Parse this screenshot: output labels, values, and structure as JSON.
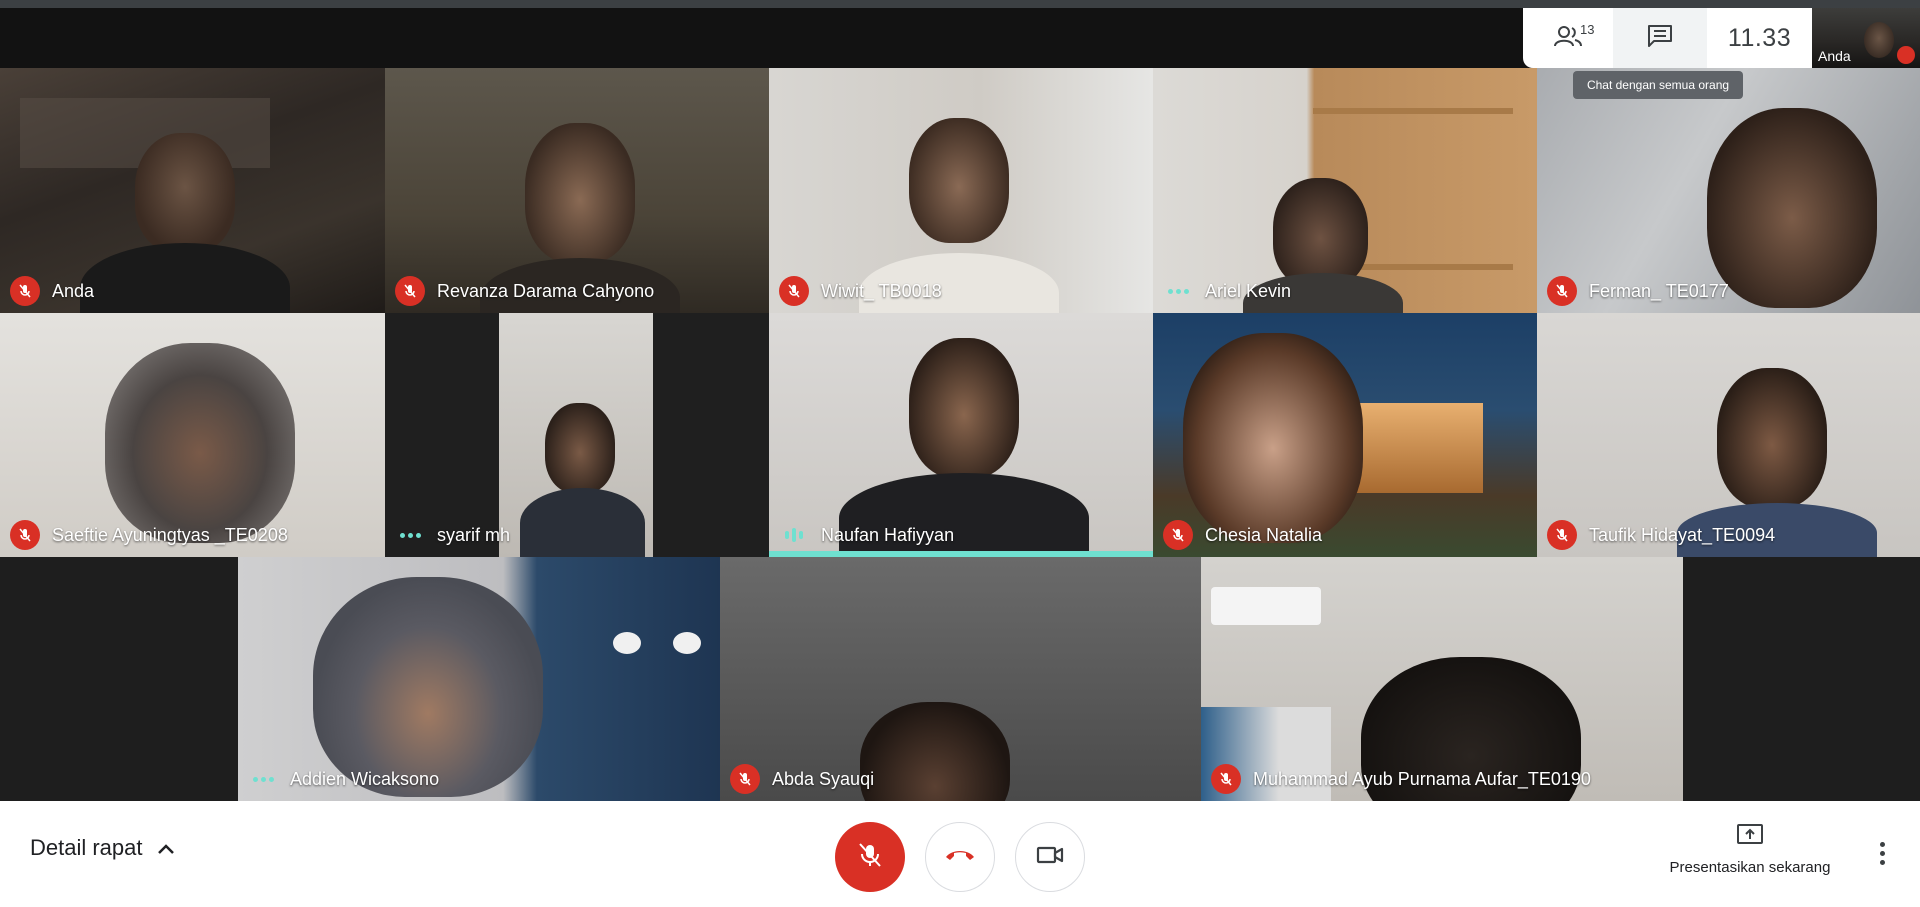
{
  "header": {
    "people_count": "13",
    "clock": "11.33",
    "self_label": "Anda",
    "tooltip": "Chat dengan semua orang"
  },
  "participants": [
    {
      "name": "Anda",
      "status": "muted"
    },
    {
      "name": "Revanza Darama Cahyono",
      "status": "muted"
    },
    {
      "name": "Wiwit_ TB0018",
      "status": "muted"
    },
    {
      "name": "Ariel Kevin",
      "status": "dots"
    },
    {
      "name": "Ferman_ TE0177",
      "status": "muted"
    },
    {
      "name": "Saeftie Ayuningtyas _TE0208",
      "status": "muted"
    },
    {
      "name": "syarif mh",
      "status": "dots"
    },
    {
      "name": "Naufan Hafiyyan",
      "status": "speaking"
    },
    {
      "name": "Chesia Natalia",
      "status": "muted"
    },
    {
      "name": "Taufik Hidayat_TE0094",
      "status": "muted"
    },
    {
      "name": "Addien Wicaksono",
      "status": "dots"
    },
    {
      "name": "Abda Syauqi",
      "status": "muted"
    },
    {
      "name": "Muhammad Ayub Purnama Aufar_TE0190",
      "status": "muted"
    }
  ],
  "footer": {
    "details_label": "Detail rapat",
    "present_label": "Presentasikan sekarang"
  },
  "colors": {
    "mute_red": "#d93025",
    "speaking_teal": "#6fe0d0"
  },
  "icons": {
    "people": "people-icon",
    "chat": "chat-icon",
    "mic_off": "mic-off-icon",
    "hangup": "phone-hangup-icon",
    "camera": "camera-icon",
    "present": "present-icon",
    "more": "more-vert-icon",
    "chevron": "chevron-up-icon"
  }
}
